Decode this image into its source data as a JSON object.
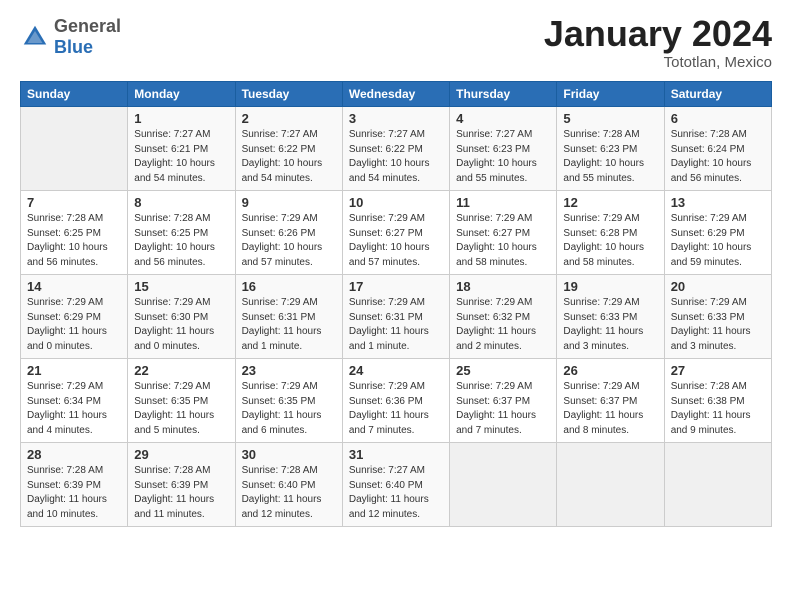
{
  "logo": {
    "general": "General",
    "blue": "Blue"
  },
  "header": {
    "month": "January 2024",
    "location": "Tototlan, Mexico"
  },
  "weekdays": [
    "Sunday",
    "Monday",
    "Tuesday",
    "Wednesday",
    "Thursday",
    "Friday",
    "Saturday"
  ],
  "weeks": [
    [
      {
        "day": "",
        "info": ""
      },
      {
        "day": "1",
        "info": "Sunrise: 7:27 AM\nSunset: 6:21 PM\nDaylight: 10 hours\nand 54 minutes."
      },
      {
        "day": "2",
        "info": "Sunrise: 7:27 AM\nSunset: 6:22 PM\nDaylight: 10 hours\nand 54 minutes."
      },
      {
        "day": "3",
        "info": "Sunrise: 7:27 AM\nSunset: 6:22 PM\nDaylight: 10 hours\nand 54 minutes."
      },
      {
        "day": "4",
        "info": "Sunrise: 7:27 AM\nSunset: 6:23 PM\nDaylight: 10 hours\nand 55 minutes."
      },
      {
        "day": "5",
        "info": "Sunrise: 7:28 AM\nSunset: 6:23 PM\nDaylight: 10 hours\nand 55 minutes."
      },
      {
        "day": "6",
        "info": "Sunrise: 7:28 AM\nSunset: 6:24 PM\nDaylight: 10 hours\nand 56 minutes."
      }
    ],
    [
      {
        "day": "7",
        "info": "Sunrise: 7:28 AM\nSunset: 6:25 PM\nDaylight: 10 hours\nand 56 minutes."
      },
      {
        "day": "8",
        "info": "Sunrise: 7:28 AM\nSunset: 6:25 PM\nDaylight: 10 hours\nand 56 minutes."
      },
      {
        "day": "9",
        "info": "Sunrise: 7:29 AM\nSunset: 6:26 PM\nDaylight: 10 hours\nand 57 minutes."
      },
      {
        "day": "10",
        "info": "Sunrise: 7:29 AM\nSunset: 6:27 PM\nDaylight: 10 hours\nand 57 minutes."
      },
      {
        "day": "11",
        "info": "Sunrise: 7:29 AM\nSunset: 6:27 PM\nDaylight: 10 hours\nand 58 minutes."
      },
      {
        "day": "12",
        "info": "Sunrise: 7:29 AM\nSunset: 6:28 PM\nDaylight: 10 hours\nand 58 minutes."
      },
      {
        "day": "13",
        "info": "Sunrise: 7:29 AM\nSunset: 6:29 PM\nDaylight: 10 hours\nand 59 minutes."
      }
    ],
    [
      {
        "day": "14",
        "info": "Sunrise: 7:29 AM\nSunset: 6:29 PM\nDaylight: 11 hours\nand 0 minutes."
      },
      {
        "day": "15",
        "info": "Sunrise: 7:29 AM\nSunset: 6:30 PM\nDaylight: 11 hours\nand 0 minutes."
      },
      {
        "day": "16",
        "info": "Sunrise: 7:29 AM\nSunset: 6:31 PM\nDaylight: 11 hours\nand 1 minute."
      },
      {
        "day": "17",
        "info": "Sunrise: 7:29 AM\nSunset: 6:31 PM\nDaylight: 11 hours\nand 1 minute."
      },
      {
        "day": "18",
        "info": "Sunrise: 7:29 AM\nSunset: 6:32 PM\nDaylight: 11 hours\nand 2 minutes."
      },
      {
        "day": "19",
        "info": "Sunrise: 7:29 AM\nSunset: 6:33 PM\nDaylight: 11 hours\nand 3 minutes."
      },
      {
        "day": "20",
        "info": "Sunrise: 7:29 AM\nSunset: 6:33 PM\nDaylight: 11 hours\nand 3 minutes."
      }
    ],
    [
      {
        "day": "21",
        "info": "Sunrise: 7:29 AM\nSunset: 6:34 PM\nDaylight: 11 hours\nand 4 minutes."
      },
      {
        "day": "22",
        "info": "Sunrise: 7:29 AM\nSunset: 6:35 PM\nDaylight: 11 hours\nand 5 minutes."
      },
      {
        "day": "23",
        "info": "Sunrise: 7:29 AM\nSunset: 6:35 PM\nDaylight: 11 hours\nand 6 minutes."
      },
      {
        "day": "24",
        "info": "Sunrise: 7:29 AM\nSunset: 6:36 PM\nDaylight: 11 hours\nand 7 minutes."
      },
      {
        "day": "25",
        "info": "Sunrise: 7:29 AM\nSunset: 6:37 PM\nDaylight: 11 hours\nand 7 minutes."
      },
      {
        "day": "26",
        "info": "Sunrise: 7:29 AM\nSunset: 6:37 PM\nDaylight: 11 hours\nand 8 minutes."
      },
      {
        "day": "27",
        "info": "Sunrise: 7:28 AM\nSunset: 6:38 PM\nDaylight: 11 hours\nand 9 minutes."
      }
    ],
    [
      {
        "day": "28",
        "info": "Sunrise: 7:28 AM\nSunset: 6:39 PM\nDaylight: 11 hours\nand 10 minutes."
      },
      {
        "day": "29",
        "info": "Sunrise: 7:28 AM\nSunset: 6:39 PM\nDaylight: 11 hours\nand 11 minutes."
      },
      {
        "day": "30",
        "info": "Sunrise: 7:28 AM\nSunset: 6:40 PM\nDaylight: 11 hours\nand 12 minutes."
      },
      {
        "day": "31",
        "info": "Sunrise: 7:27 AM\nSunset: 6:40 PM\nDaylight: 11 hours\nand 12 minutes."
      },
      {
        "day": "",
        "info": ""
      },
      {
        "day": "",
        "info": ""
      },
      {
        "day": "",
        "info": ""
      }
    ]
  ]
}
